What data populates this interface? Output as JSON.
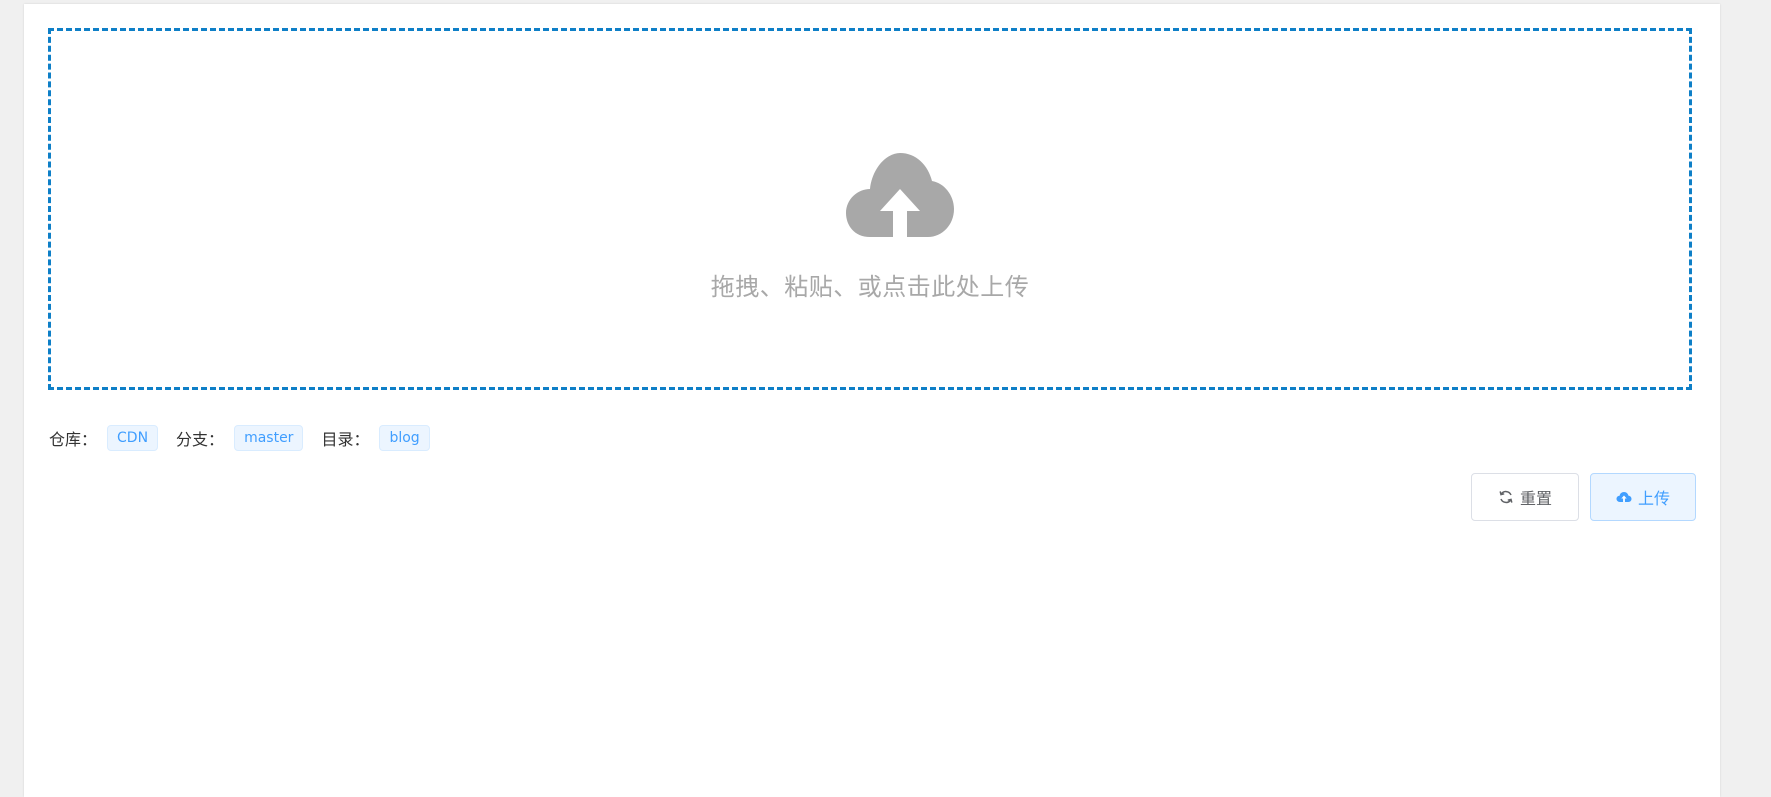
{
  "dropzone": {
    "icon": "cloud-upload-icon",
    "text": "拖拽、粘贴、或点击此处上传",
    "border_color": "#0e7fc7",
    "icon_color": "#a8a8a8"
  },
  "meta": {
    "repo_label": "仓库：",
    "repo_value": "CDN",
    "branch_label": "分支：",
    "branch_value": "master",
    "dir_label": "目录：",
    "dir_value": "blog"
  },
  "actions": {
    "reset_label": "重置",
    "reset_icon": "refresh-icon",
    "upload_label": "上传",
    "upload_icon": "cloud-upload-icon",
    "accent_color": "#409eff"
  }
}
